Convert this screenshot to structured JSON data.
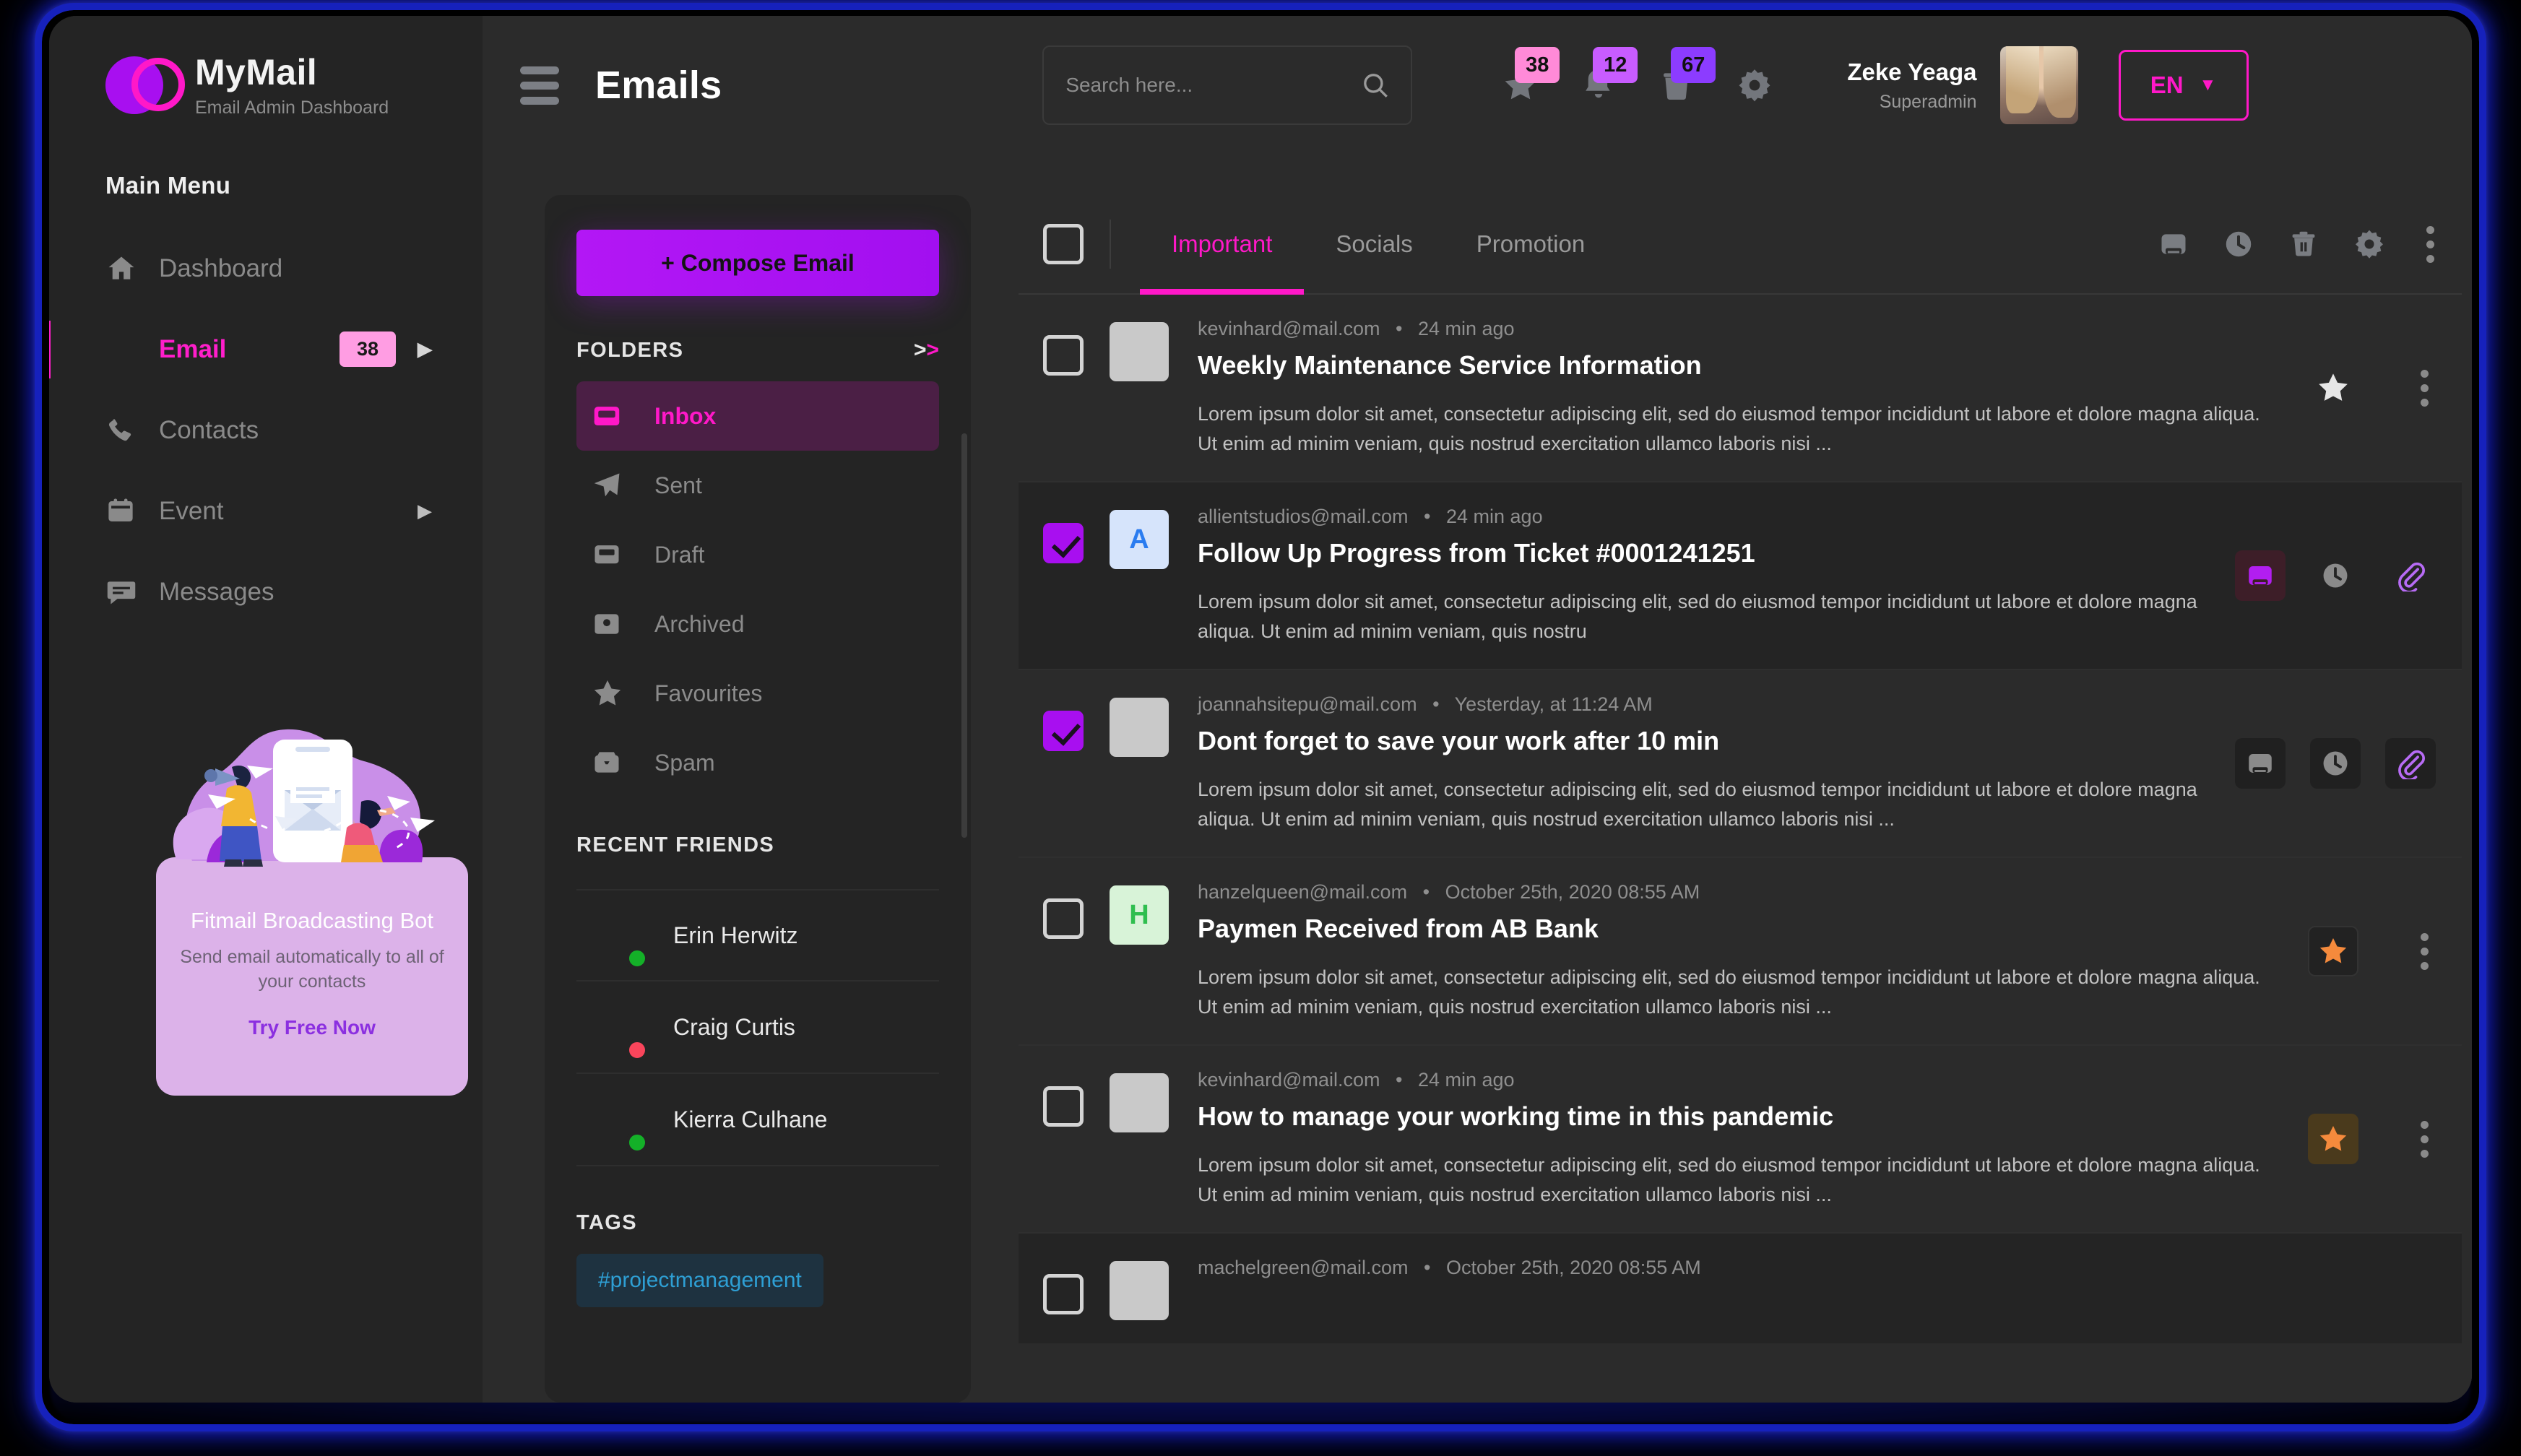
{
  "brand": {
    "name": "MyMail",
    "subtitle": "Email Admin Dashboard",
    "logo_purple": "#a80ff0",
    "logo_pink": "#ff18c8"
  },
  "sidebar": {
    "menu_title": "Main Menu",
    "items": [
      {
        "label": "Dashboard",
        "icon": "home-icon",
        "badge": null,
        "caret": false,
        "active": false
      },
      {
        "label": "Email",
        "icon": "mail-icon",
        "badge": "38",
        "caret": true,
        "active": true
      },
      {
        "label": "Contacts",
        "icon": "phone-icon",
        "badge": null,
        "caret": false,
        "active": false
      },
      {
        "label": "Event",
        "icon": "calendar-icon",
        "badge": null,
        "caret": true,
        "active": false
      },
      {
        "label": "Messages",
        "icon": "chat-icon",
        "badge": null,
        "caret": false,
        "active": false
      }
    ],
    "promo": {
      "title": "Fitmail Broadcasting Bot",
      "description": "Send email automatically to all of your contacts",
      "cta": "Try Free Now"
    }
  },
  "header": {
    "menu_toggle": "hamburger-icon",
    "title": "Emails",
    "search": {
      "value": "",
      "placeholder": "Search here..."
    },
    "icons": [
      {
        "name": "star-icon",
        "badge": "38",
        "badge_color": "#ff8ad8"
      },
      {
        "name": "bell-icon",
        "badge": "12",
        "badge_color": "#c85cff"
      },
      {
        "name": "trash-icon",
        "badge": "67",
        "badge_color": "#8c3cff"
      },
      {
        "name": "gear-icon",
        "badge": null,
        "badge_color": null
      }
    ],
    "user": {
      "name": "Zeke Yeaga",
      "role": "Superadmin"
    },
    "language": {
      "code": "EN"
    }
  },
  "mailnav": {
    "compose_label": "+ Compose Email",
    "folders_title": "FOLDERS",
    "folders_more": ">>",
    "folders": [
      {
        "label": "Inbox",
        "icon": "inbox-icon",
        "active": true
      },
      {
        "label": "Sent",
        "icon": "send-icon",
        "active": false
      },
      {
        "label": "Draft",
        "icon": "draft-icon",
        "active": false
      },
      {
        "label": "Archived",
        "icon": "archive-icon",
        "active": false
      },
      {
        "label": "Favourites",
        "icon": "star-icon",
        "active": false
      },
      {
        "label": "Spam",
        "icon": "spam-icon",
        "active": false
      }
    ],
    "friends_title": "RECENT FRIENDS",
    "friends": [
      {
        "name": "Erin Herwitz",
        "status_color": "#14b028"
      },
      {
        "name": "Craig Curtis",
        "status_color": "#f9455b"
      },
      {
        "name": "Kierra Culhane",
        "status_color": "#14b028"
      }
    ],
    "tags_title": "TAGS",
    "tags": [
      "#projectmanagement"
    ]
  },
  "maillist": {
    "select_all_checked": false,
    "tabs": [
      {
        "label": "Important",
        "active": true
      },
      {
        "label": "Socials",
        "active": false
      },
      {
        "label": "Promotion",
        "active": false
      }
    ],
    "tools": [
      "archive-icon",
      "clock-icon",
      "trash-icon",
      "gear-icon",
      "more-vertical-icon"
    ],
    "rows": [
      {
        "checked": false,
        "avatar_letter": "",
        "avatar_bg": "#c9c9c9",
        "avatar_fg": "#c9c9c9",
        "sender": "kevinhard@mail.com",
        "time": "24 min ago",
        "subject": "Weekly Maintenance Service Information",
        "excerpt": "Lorem ipsum dolor sit amet, consectetur adipiscing elit, sed do eiusmod tempor incididunt ut labore et dolore magna aliqua. Ut enim ad minim veniam, quis nostrud exercitation ullamco laboris nisi ...",
        "actions": [
          "star-plain",
          "more-vertical-icon"
        ],
        "alt": false
      },
      {
        "checked": true,
        "avatar_letter": "A",
        "avatar_bg": "#d6e4fb",
        "avatar_fg": "#2a7cf0",
        "sender": "allientstudios@mail.com",
        "time": "24 min ago",
        "subject": "Follow Up Progress from Ticket #0001241251",
        "excerpt": "Lorem ipsum dolor sit amet, consectetur adipiscing elit, sed do eiusmod tempor incididunt ut labore et dolore magna aliqua. Ut enim ad minim veniam, quis nostru",
        "actions": [
          "archive-icon-highlight",
          "clock-icon",
          "paperclip-icon"
        ],
        "alt": true
      },
      {
        "checked": true,
        "avatar_letter": "",
        "avatar_bg": "#c9c9c9",
        "avatar_fg": "#c9c9c9",
        "sender": "joannahsitepu@mail.com",
        "time": "Yesterday, at 11:24 AM",
        "subject": "Dont forget to save your work after 10 min",
        "excerpt": "Lorem ipsum dolor sit amet, consectetur adipiscing elit, sed do eiusmod tempor incididunt ut labore et dolore magna aliqua. Ut enim ad minim veniam, quis nostrud exercitation ullamco laboris nisi ...",
        "actions": [
          "archive-icon",
          "clock-icon",
          "paperclip-icon"
        ],
        "alt": false
      },
      {
        "checked": false,
        "avatar_letter": "H",
        "avatar_bg": "#d8f3d8",
        "avatar_fg": "#2fbe4f",
        "sender": "hanzelqueen@mail.com",
        "time": "October 25th, 2020  08:55 AM",
        "subject": "Paymen Received from AB Bank",
        "excerpt": "Lorem ipsum dolor sit amet, consectetur adipiscing elit, sed do eiusmod tempor incididunt ut labore et dolore magna aliqua. Ut enim ad minim veniam, quis nostrud exercitation ullamco laboris nisi ...",
        "actions": [
          "star-box",
          "more-vertical-icon"
        ],
        "alt": false
      },
      {
        "checked": false,
        "avatar_letter": "",
        "avatar_bg": "#c9c9c9",
        "avatar_fg": "#c9c9c9",
        "sender": "kevinhard@mail.com",
        "time": "24 min ago",
        "subject": "How to manage your working time in this pandemic",
        "excerpt": "Lorem ipsum dolor sit amet, consectetur adipiscing elit, sed do eiusmod tempor incididunt ut labore et dolore magna aliqua. Ut enim ad minim veniam, quis nostrud exercitation ullamco laboris nisi ...",
        "actions": [
          "star-gold",
          "more-vertical-icon"
        ],
        "alt": false
      },
      {
        "checked": false,
        "avatar_letter": "",
        "avatar_bg": "#c9c9c9",
        "avatar_fg": "#c9c9c9",
        "sender": "machelgreen@mail.com",
        "time": "October 25th, 2020  08:55 AM",
        "subject": "",
        "excerpt": "",
        "actions": [],
        "alt": true
      }
    ]
  }
}
